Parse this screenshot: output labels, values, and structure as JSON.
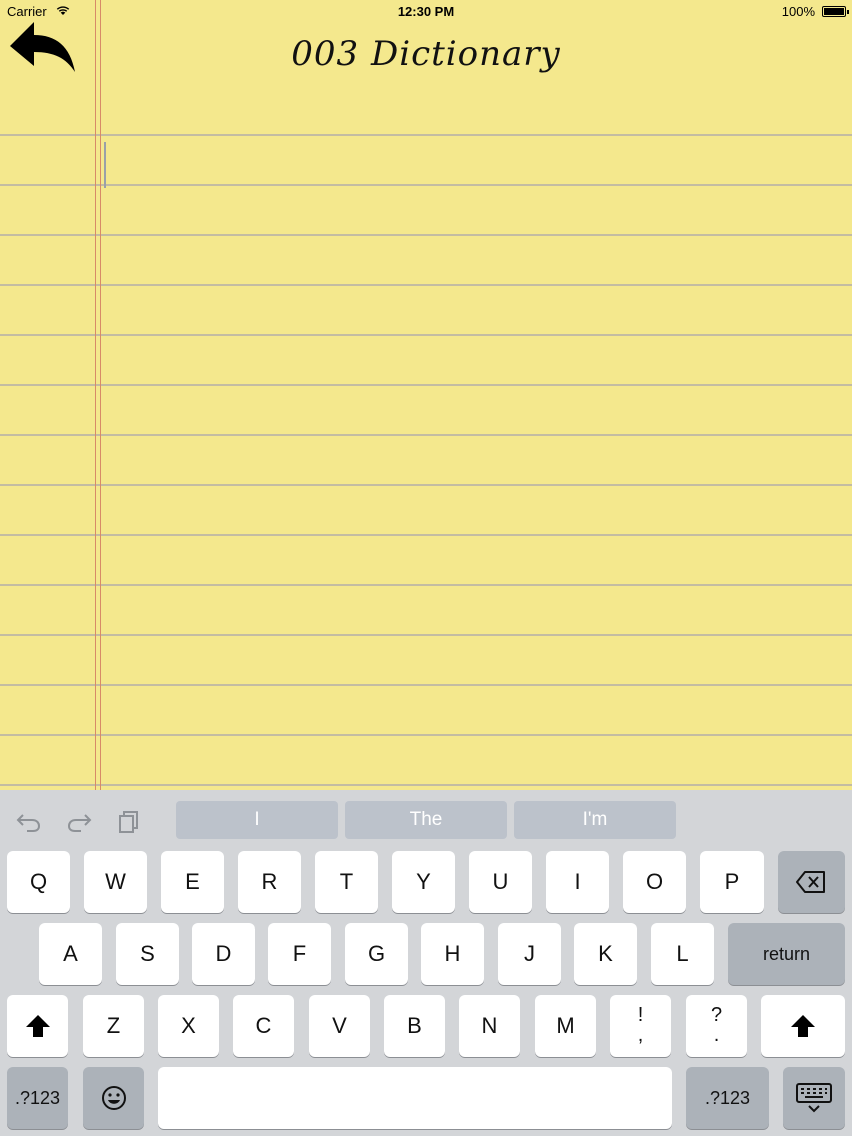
{
  "status": {
    "carrier": "Carrier",
    "time": "12:30 PM",
    "battery": "100%"
  },
  "header": {
    "title": "003 Dictionary"
  },
  "keyboard": {
    "suggestions": [
      "I",
      "The",
      "I'm"
    ],
    "row1": [
      "Q",
      "W",
      "E",
      "R",
      "T",
      "Y",
      "U",
      "I",
      "O",
      "P"
    ],
    "row2": [
      "A",
      "S",
      "D",
      "F",
      "G",
      "H",
      "J",
      "K",
      "L"
    ],
    "row3": [
      "Z",
      "X",
      "C",
      "V",
      "B",
      "N",
      "M"
    ],
    "punct1": [
      "!",
      ","
    ],
    "punct2": [
      "?",
      "."
    ],
    "return_label": "return",
    "numbers_label": ".?123",
    "colors": {
      "paper": "#f4e88d",
      "keyboard": "#d3d5d8",
      "key": "#ffffff",
      "dark_key": "#acb2b9"
    }
  }
}
